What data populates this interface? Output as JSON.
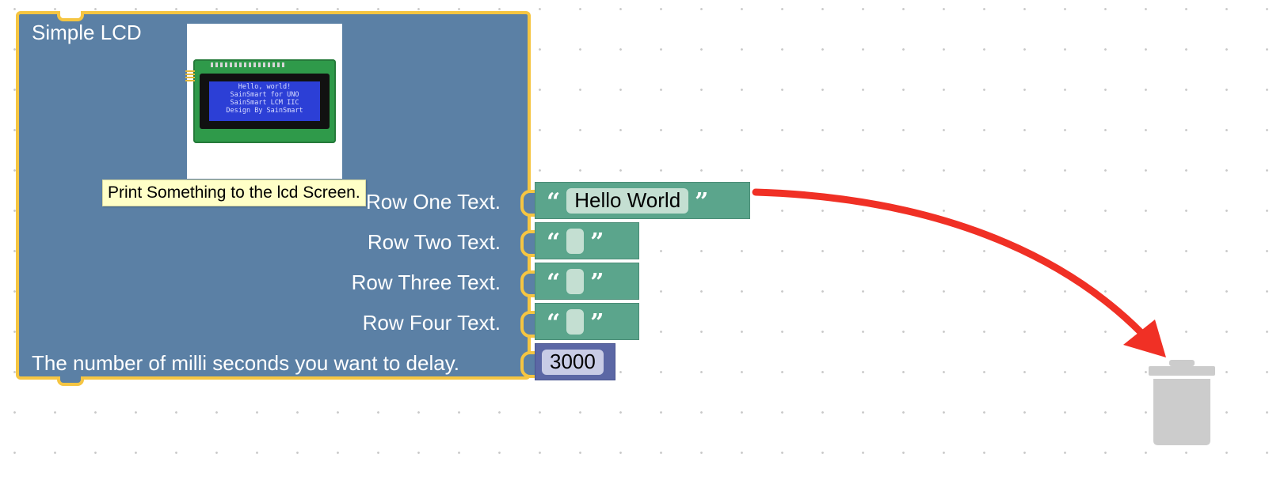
{
  "block": {
    "title": "Simple LCD",
    "image": {
      "alt": "LCD display image",
      "screen_lines": [
        "Hello, world!",
        "SainSmart for UNO",
        "SainSmart LCM IIC",
        "Design By SainSmart"
      ]
    },
    "rows": [
      {
        "label": "Row One Text.",
        "value": "Hello World"
      },
      {
        "label": "Row Two Text.",
        "value": ""
      },
      {
        "label": "Row Three Text.",
        "value": ""
      },
      {
        "label": "Row Four Text.",
        "value": ""
      }
    ],
    "delay_label": "The number of milli seconds you want to delay.",
    "delay_value": "3000"
  },
  "tooltip": "Print Something to the lcd Screen.",
  "quote_open": "“",
  "quote_close": "”",
  "icons": {
    "trash": "trash-can-icon",
    "arrow": "drag-to-trash-arrow-icon"
  },
  "colors": {
    "block": "#5b80a5",
    "block_border": "#f5c542",
    "text_block": "#5ba58c",
    "math_block": "#5b67a5",
    "tooltip": "#ffffc7",
    "arrow": "#f03025",
    "trash": "#cccccc"
  }
}
